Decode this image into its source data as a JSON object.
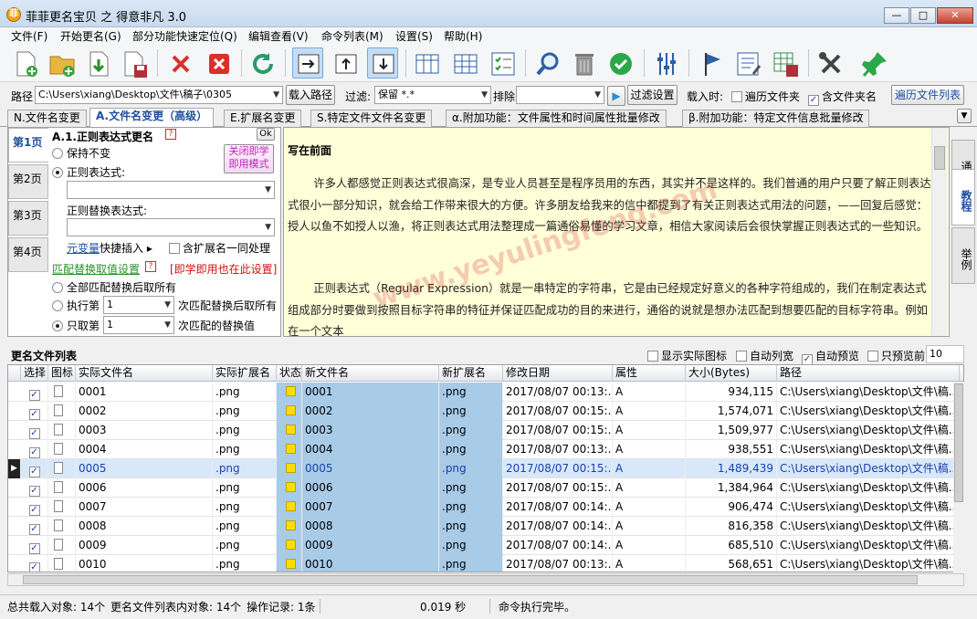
{
  "window": {
    "title": "菲菲更名宝贝 之 得意非凡 3.0",
    "icon": "app-icon",
    "min_label": "—",
    "max_label": "□",
    "close_label": "✕"
  },
  "menu": [
    "文件(F)",
    "开始更名(G)",
    "部分功能快速定位(Q)",
    "编辑查看(V)",
    "命令列表(M)",
    "设置(S)",
    "帮助(H)"
  ],
  "toolbar": {
    "icons": [
      "new-file-icon",
      "open-folder-icon",
      "import-icon",
      "save-icon",
      "delete-icon",
      "close-icon",
      "refresh-icon",
      "layout-right-icon",
      "layout-up-icon",
      "layout-down-icon",
      "columns-icon",
      "grid-icon",
      "checklist-icon",
      "search-icon",
      "trash-icon",
      "ok-icon",
      "adjust-icon",
      "flag-icon",
      "edit-document-icon",
      "save-grid-icon",
      "tools-icon",
      "pin-icon"
    ],
    "pressed": [
      "layout-right-icon",
      "layout-down-icon"
    ]
  },
  "pathbar": {
    "path_label": "路径",
    "path_value": "C:\\Users\\xiang\\Desktop\\文件\\稿子\\0305",
    "load_button": "载入路径",
    "filter_label": "过滤:",
    "filter_value": "保留 *.*",
    "exclude_label": "排除",
    "exclude_value": "",
    "filter_settings_button": "过滤设置",
    "load_time_label": "载入时:",
    "traverse_folders_label": "遍历文件夹",
    "traverse_folders_checked": false,
    "include_folder_name_label": "含文件夹名",
    "include_folder_name_checked": true,
    "traverse_list_button": "遍历文件列表"
  },
  "tabs": [
    {
      "label": "N.文件名变更",
      "active": false
    },
    {
      "label": "A.文件名变更（高级）",
      "active": true
    },
    {
      "label": "E.扩展名变更",
      "active": false
    },
    {
      "label": "S.特定文件文件名变更",
      "active": false
    },
    {
      "label": "α.附加功能：文件属性和时间属性批量修改",
      "active": false
    },
    {
      "label": "β.附加功能：特定文件信息批量修改",
      "active": false
    }
  ],
  "left_panel": {
    "pages": [
      "第1页",
      "第2页",
      "第3页",
      "第4页"
    ],
    "section_title": "A.1.正则表达式更名",
    "help_mark": "?",
    "ok_button": "Ok",
    "keep_label": "保持不变",
    "regex_label": "正则表达式:",
    "close_instant_button": "关闭即学\n即用模式",
    "regex_value": "",
    "replace_label": "正则替换表达式:",
    "replace_value": "",
    "metavar_link": "元变量",
    "quick_insert_label": "快捷插入",
    "with_ext_label": "含扩展名一同处理",
    "match_settings_link": "匹配替换取值设置",
    "instant_hint": "[即学即用也在此设置]",
    "opt_all": "全部匹配替换后取所有",
    "opt_exec_prefix": "执行第",
    "opt_exec_value": "1",
    "opt_exec_suffix": "次匹配替换后取所有",
    "opt_only_prefix": "只取第",
    "opt_only_value": "1",
    "opt_only_suffix": "次匹配的替换值"
  },
  "doc": {
    "title": "写在前面",
    "para1": "许多人都感觉正则表达式很高深，是专业人员甚至是程序员用的东西，其实并不是这样的。我们普通的用户只要了解正则表达式很小一部分知识，就会给工作带来很大的方便。许多朋友给我来的信中都提到了有关正则表达式用法的问题，——回复后感觉：授人以鱼不如授人以渔，将正则表达式用法整理成一篇通俗易懂的学习文章，相信大家阅读后会很快掌握正则表达式的一些知识。",
    "para2": "正则表达式（Regular Expression）就是一串特定的字符串，它是由已经规定好意义的各种字符组成的，我们在制定表达式组成部分时要做到按照目标字符串的特征并保证匹配成功的目的来进行，通俗的说就是想办法匹配到想要匹配的目标字符串。例如在一个文本",
    "right_tabs": [
      "通讯",
      "教程",
      "举例"
    ],
    "active_right_tab": "教程"
  },
  "list": {
    "title": "更名文件列表",
    "show_icons_label": "显示实际图标",
    "show_icons_checked": false,
    "auto_width_label": "自动列宽",
    "auto_width_checked": false,
    "auto_preview_label": "自动预览",
    "auto_preview_checked": true,
    "preview_first_label": "只预览前",
    "preview_first_value": "10",
    "columns": [
      "选择",
      "图标",
      "实际文件名",
      "实际扩展名",
      "状态",
      "新文件名",
      "新扩展名",
      "修改日期",
      "属性",
      "大小(Bytes)",
      "路径"
    ],
    "rows": [
      {
        "name": "0001",
        "ext": ".png",
        "new_name": "0001",
        "new_ext": ".png",
        "date": "2017/08/07 00:13:...",
        "attr": "A",
        "size": "934,115",
        "path": "C:\\Users\\xiang\\Desktop\\文件\\稿..."
      },
      {
        "name": "0002",
        "ext": ".png",
        "new_name": "0002",
        "new_ext": ".png",
        "date": "2017/08/07 00:15:...",
        "attr": "A",
        "size": "1,574,071",
        "path": "C:\\Users\\xiang\\Desktop\\文件\\稿..."
      },
      {
        "name": "0003",
        "ext": ".png",
        "new_name": "0003",
        "new_ext": ".png",
        "date": "2017/08/07 00:15:...",
        "attr": "A",
        "size": "1,509,977",
        "path": "C:\\Users\\xiang\\Desktop\\文件\\稿..."
      },
      {
        "name": "0004",
        "ext": ".png",
        "new_name": "0004",
        "new_ext": ".png",
        "date": "2017/08/07 00:13:...",
        "attr": "A",
        "size": "938,551",
        "path": "C:\\Users\\xiang\\Desktop\\文件\\稿..."
      },
      {
        "name": "0005",
        "ext": ".png",
        "new_name": "0005",
        "new_ext": ".png",
        "date": "2017/08/07 00:15:...",
        "attr": "A",
        "size": "1,489,439",
        "path": "C:\\Users\\xiang\\Desktop\\文件\\稿...",
        "selected": true
      },
      {
        "name": "0006",
        "ext": ".png",
        "new_name": "0006",
        "new_ext": ".png",
        "date": "2017/08/07 00:15:...",
        "attr": "A",
        "size": "1,384,964",
        "path": "C:\\Users\\xiang\\Desktop\\文件\\稿..."
      },
      {
        "name": "0007",
        "ext": ".png",
        "new_name": "0007",
        "new_ext": ".png",
        "date": "2017/08/07 00:14:...",
        "attr": "A",
        "size": "906,474",
        "path": "C:\\Users\\xiang\\Desktop\\文件\\稿..."
      },
      {
        "name": "0008",
        "ext": ".png",
        "new_name": "0008",
        "new_ext": ".png",
        "date": "2017/08/07 00:14:...",
        "attr": "A",
        "size": "816,358",
        "path": "C:\\Users\\xiang\\Desktop\\文件\\稿..."
      },
      {
        "name": "0009",
        "ext": ".png",
        "new_name": "0009",
        "new_ext": ".png",
        "date": "2017/08/07 00:14:...",
        "attr": "A",
        "size": "685,510",
        "path": "C:\\Users\\xiang\\Desktop\\文件\\稿..."
      },
      {
        "name": "0010",
        "ext": ".png",
        "new_name": "0010",
        "new_ext": ".png",
        "date": "2017/08/07 00:13:...",
        "attr": "A",
        "size": "568,651",
        "path": "C:\\Users\\xiang\\Desktop\\文件\\稿..."
      }
    ]
  },
  "status": {
    "total_loaded": "总共载入对象: 14个",
    "in_list": "更名文件列表内对象: 14个",
    "op_records": "操作记录: 1条",
    "elapsed": "0.019 秒",
    "message": "命令执行完毕。"
  },
  "watermark": "www.yeyulingfeng.com",
  "colors": {
    "accent": "#1f4fa0",
    "new_name_cell": "#a8cbe8",
    "doc_bg": "#ffffd8",
    "hint_red": "#d01010"
  }
}
